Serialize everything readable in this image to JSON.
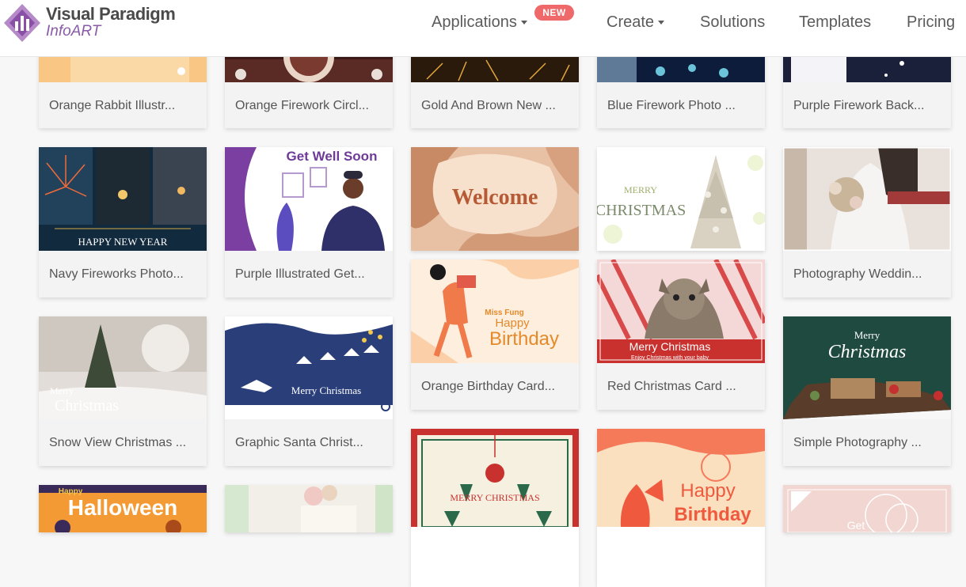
{
  "header": {
    "brand": "Visual Paradigm",
    "product": "InfoART",
    "nav": {
      "applications": "Applications",
      "new_badge": "NEW",
      "create": "Create",
      "solutions": "Solutions",
      "templates": "Templates",
      "pricing": "Pricing"
    }
  },
  "thumb_text": {
    "get_well_soon": "Get Well Soon",
    "welcome": "Welcome",
    "merry": "MERRY",
    "christmas_caps": "CHRISTMAS",
    "happy_new_year": "HAPPY NEW YEAR",
    "merry_script": "Merry",
    "christmas_script": "Christmas",
    "merry_christmas": "Merry Christmas",
    "enjoy_christmas": "Enjoy Christmas with your baby",
    "miss_fung": "Miss Fung",
    "happy": "Happy",
    "birthday": "Birthday",
    "merry_christmas_caps": "MERRY CHRISTMAS",
    "halloween_happy": "Happy",
    "halloween": "Halloween",
    "get": "Get",
    "merry_christmas_script": "Merry Christmas"
  },
  "cards": [
    {
      "title": "Orange Rabbit Illustr..."
    },
    {
      "title": "Orange Firework Circl..."
    },
    {
      "title": "Gold And Brown New ..."
    },
    {
      "title": "Blue Firework Photo ..."
    },
    {
      "title": "Purple Firework Back..."
    },
    {
      "title": "Navy Fireworks Photo..."
    },
    {
      "title": "Purple Illustrated Get..."
    },
    {
      "title": "Photography Weddin..."
    },
    {
      "title": "Orange Birthday Card..."
    },
    {
      "title": "Red Christmas Card ..."
    },
    {
      "title": "Snow View Christmas ..."
    },
    {
      "title": "Graphic Santa Christ..."
    },
    {
      "title": "Simple Photography ..."
    }
  ]
}
